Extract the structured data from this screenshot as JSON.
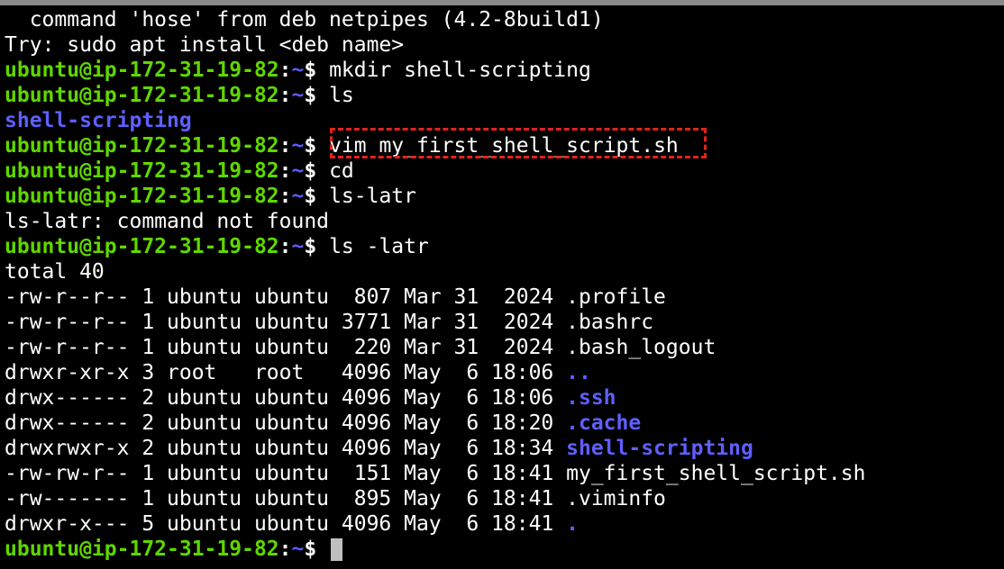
{
  "terminal": {
    "prompt": {
      "user_host": "ubuntu@ip-172-31-19-82",
      "colon": ":",
      "path": "~",
      "dollar": "$ "
    },
    "lines": [
      {
        "type": "output",
        "text": "  command 'hose' from deb netpipes (4.2-8build1)"
      },
      {
        "type": "output",
        "text": "Try: sudo apt install <deb name>"
      },
      {
        "type": "prompt",
        "command": "mkdir shell-scripting"
      },
      {
        "type": "prompt",
        "command": "ls"
      },
      {
        "type": "dir",
        "text": "shell-scripting"
      },
      {
        "type": "prompt",
        "command": "vim my_first_shell_script.sh",
        "highlighted": true
      },
      {
        "type": "prompt",
        "command": "cd"
      },
      {
        "type": "prompt",
        "command": "ls-latr"
      },
      {
        "type": "output",
        "text": "ls-latr: command not found"
      },
      {
        "type": "prompt",
        "command": "ls -latr"
      },
      {
        "type": "output",
        "text": "total 40"
      }
    ],
    "listing": [
      {
        "meta": "-rw-r--r-- 1 ubuntu ubuntu  807 Mar 31  2024 ",
        "name": ".profile",
        "is_dir": false
      },
      {
        "meta": "-rw-r--r-- 1 ubuntu ubuntu 3771 Mar 31  2024 ",
        "name": ".bashrc",
        "is_dir": false
      },
      {
        "meta": "-rw-r--r-- 1 ubuntu ubuntu  220 Mar 31  2024 ",
        "name": ".bash_logout",
        "is_dir": false
      },
      {
        "meta": "drwxr-xr-x 3 root   root   4096 May  6 18:06 ",
        "name": "..",
        "is_dir": true
      },
      {
        "meta": "drwx------ 2 ubuntu ubuntu 4096 May  6 18:06 ",
        "name": ".ssh",
        "is_dir": true
      },
      {
        "meta": "drwx------ 2 ubuntu ubuntu 4096 May  6 18:20 ",
        "name": ".cache",
        "is_dir": true
      },
      {
        "meta": "drwxrwxr-x 2 ubuntu ubuntu 4096 May  6 18:34 ",
        "name": "shell-scripting",
        "is_dir": true
      },
      {
        "meta": "-rw-rw-r-- 1 ubuntu ubuntu  151 May  6 18:41 ",
        "name": "my_first_shell_script.sh",
        "is_dir": false
      },
      {
        "meta": "-rw------- 1 ubuntu ubuntu  895 May  6 18:41 ",
        "name": ".viminfo",
        "is_dir": false
      },
      {
        "meta": "drwxr-x--- 5 ubuntu ubuntu 4096 May  6 18:41 ",
        "name": ".",
        "is_dir": true
      }
    ],
    "colors": {
      "background": "#000000",
      "prompt_user": "#5fd700",
      "directory": "#5f5fff",
      "highlight_box": "#e0241b"
    }
  }
}
